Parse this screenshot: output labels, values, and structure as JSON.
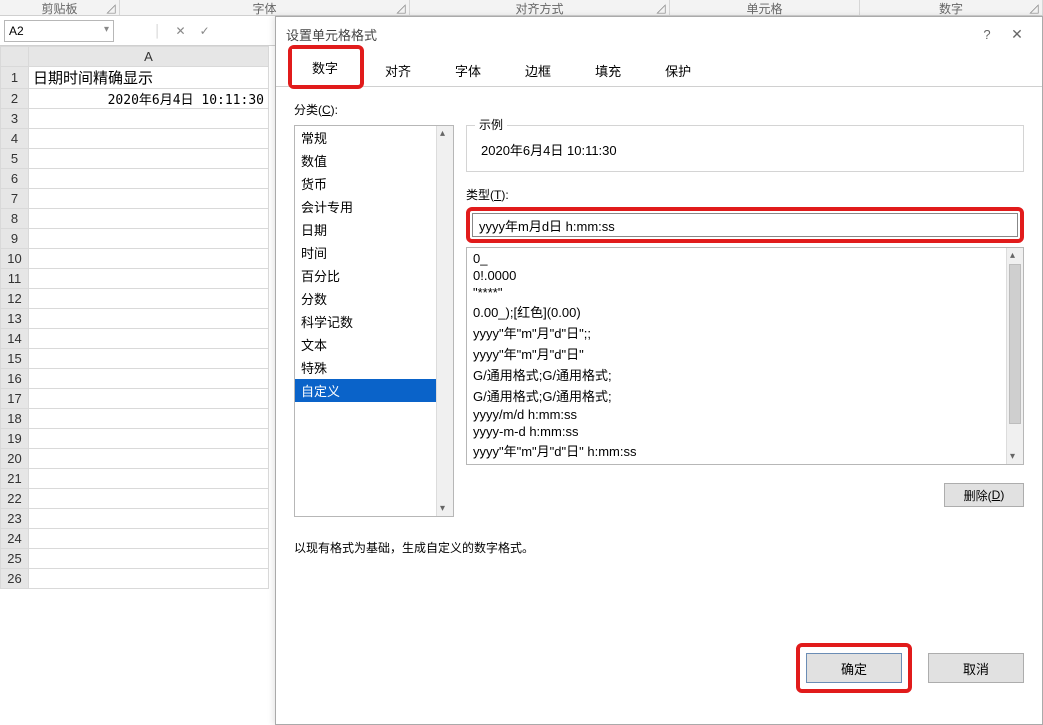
{
  "ribbon_groups": [
    "剪贴板",
    "字体",
    "对齐方式",
    "单元格",
    "数字"
  ],
  "namebox_value": "A2",
  "sheet": {
    "col_header": "A",
    "rows": [
      {
        "n": "1",
        "a": "日期时间精确显示"
      },
      {
        "n": "2",
        "a": "2020年6月4日 10:11:30"
      },
      {
        "n": "3",
        "a": ""
      },
      {
        "n": "4",
        "a": ""
      },
      {
        "n": "5",
        "a": ""
      },
      {
        "n": "6",
        "a": ""
      },
      {
        "n": "7",
        "a": ""
      },
      {
        "n": "8",
        "a": ""
      },
      {
        "n": "9",
        "a": ""
      },
      {
        "n": "10",
        "a": ""
      },
      {
        "n": "11",
        "a": ""
      },
      {
        "n": "12",
        "a": ""
      },
      {
        "n": "13",
        "a": ""
      },
      {
        "n": "14",
        "a": ""
      },
      {
        "n": "15",
        "a": ""
      },
      {
        "n": "16",
        "a": ""
      },
      {
        "n": "17",
        "a": ""
      },
      {
        "n": "18",
        "a": ""
      },
      {
        "n": "19",
        "a": ""
      },
      {
        "n": "20",
        "a": ""
      },
      {
        "n": "21",
        "a": ""
      },
      {
        "n": "22",
        "a": ""
      },
      {
        "n": "23",
        "a": ""
      },
      {
        "n": "24",
        "a": ""
      },
      {
        "n": "25",
        "a": ""
      },
      {
        "n": "26",
        "a": ""
      }
    ]
  },
  "dialog": {
    "title": "设置单元格格式",
    "help": "?",
    "close": "✕",
    "tabs": [
      "数字",
      "对齐",
      "字体",
      "边框",
      "填充",
      "保护"
    ],
    "category_label_prefix": "分类(",
    "category_label_key": "C",
    "category_label_suffix": "):",
    "categories": [
      "常规",
      "数值",
      "货币",
      "会计专用",
      "日期",
      "时间",
      "百分比",
      "分数",
      "科学记数",
      "文本",
      "特殊",
      "自定义"
    ],
    "selected_category_index": 11,
    "example_label": "示例",
    "example_value": "2020年6月4日 10:11:30",
    "type_label_prefix": "类型(",
    "type_label_key": "T",
    "type_label_suffix": "):",
    "type_value": "yyyy年m月d日 h:mm:ss",
    "format_list": [
      "0_",
      "0!.0000",
      "\"****\"",
      "0.00_);[红色](0.00)",
      "yyyy\"年\"m\"月\"d\"日\";;",
      "yyyy\"年\"m\"月\"d\"日\"",
      "G/通用格式;G/通用格式;",
      "G/通用格式;G/通用格式;",
      "yyyy/m/d h:mm:ss",
      "yyyy-m-d h:mm:ss",
      "yyyy\"年\"m\"月\"d\"日\" h:mm:ss"
    ],
    "delete_label_prefix": "删除(",
    "delete_label_key": "D",
    "delete_label_suffix": ")",
    "hint": "以现有格式为基础，生成自定义的数字格式。",
    "ok": "确定",
    "cancel": "取消"
  }
}
